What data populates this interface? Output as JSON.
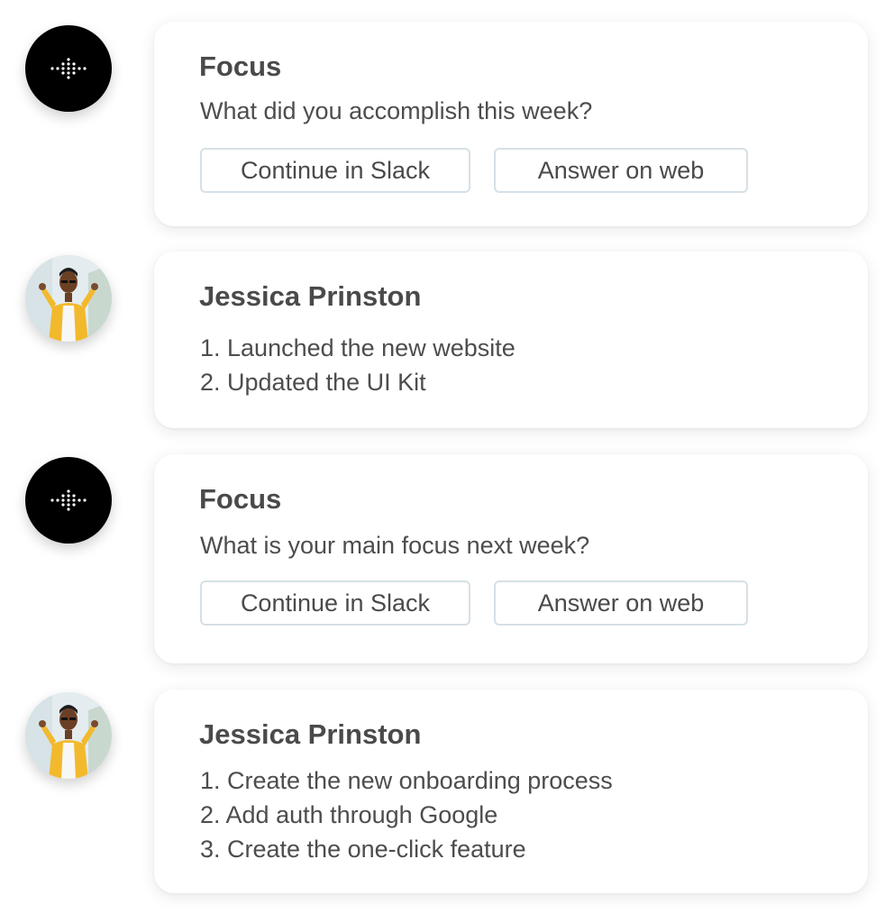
{
  "messages": [
    {
      "author": "Focus",
      "question": "What did you accomplish this week?",
      "buttons": [
        "Continue in Slack",
        "Answer on web"
      ]
    },
    {
      "author": "Jessica Prinston",
      "items": [
        "1. Launched the new website",
        "2. Updated the UI Kit"
      ]
    },
    {
      "author": "Focus",
      "question": "What is your main focus next week?",
      "buttons": [
        "Continue in Slack",
        "Answer on web"
      ]
    },
    {
      "author": "Jessica Prinston",
      "items": [
        "1. Create the new onboarding process",
        "2. Add auth through Google",
        "3. Create the one-click feature"
      ]
    }
  ],
  "colors": {
    "bot_avatar_bg": "#000000",
    "button_border": "#d6e0e6",
    "text": "#4a4a4a",
    "jacket": "#f2b92c"
  },
  "icons": {
    "bot_logo": "focus-dots-logo-icon",
    "person_avatar": "jessica-avatar-photo"
  }
}
